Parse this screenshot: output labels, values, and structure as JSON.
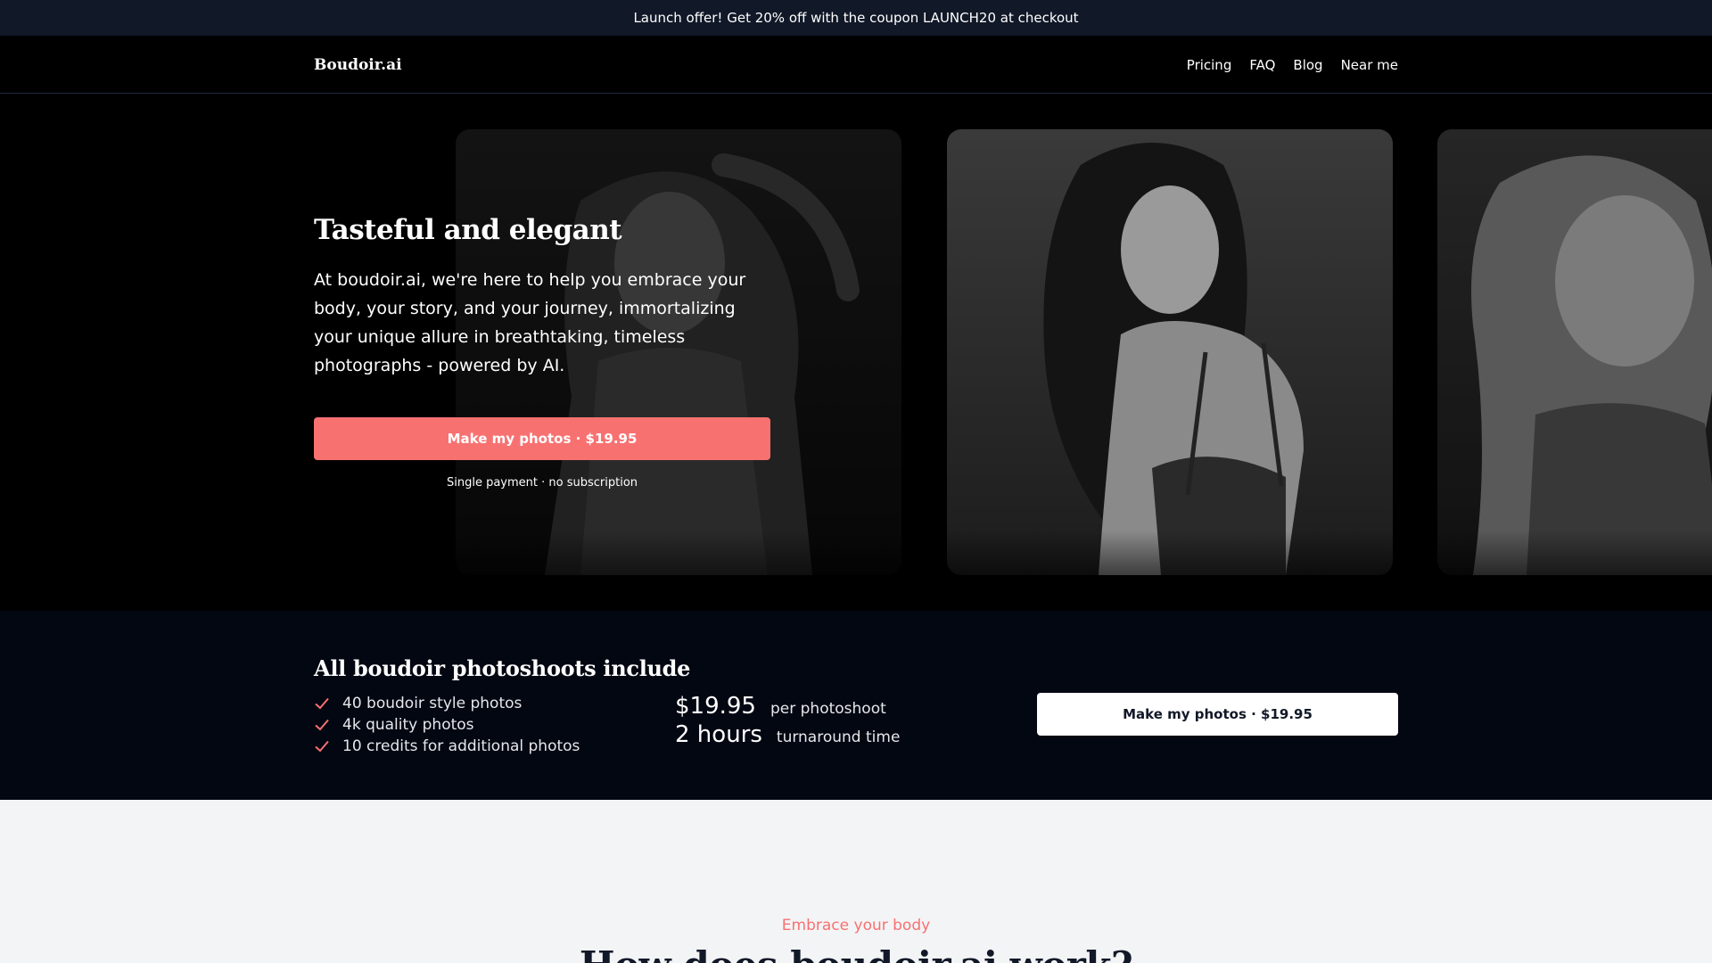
{
  "announcement": {
    "text": "Launch offer! Get 20% off with the coupon LAUNCH20 at checkout"
  },
  "nav": {
    "logo": "Boudoir.ai",
    "links": [
      "Pricing",
      "FAQ",
      "Blog",
      "Near me"
    ]
  },
  "hero": {
    "title": "Tasteful and elegant",
    "text": "At boudoir.ai, we're here to help you embrace your body, your story, and your journey, immortalizing your unique allure in breathtaking, timeless photographs - powered by AI.",
    "cta_label": "Make my photos · $19.95",
    "cta_note": "Single payment · no subscription"
  },
  "includes": {
    "title": "All boudoir photoshoots include",
    "items": [
      "40 boudoir style photos",
      "4k quality photos",
      "10 credits for additional photos"
    ],
    "stats": [
      {
        "value": "$19.95",
        "label": "per photoshoot"
      },
      {
        "value": "2 hours",
        "label": "turnaround time"
      }
    ],
    "cta_label": "Make my photos · $19.95"
  },
  "how": {
    "eyebrow": "Embrace your body",
    "title": "How does boudoir.ai work?"
  },
  "colors": {
    "accent": "#f87171",
    "announce_bg": "#111827",
    "band_bg": "#030712"
  }
}
